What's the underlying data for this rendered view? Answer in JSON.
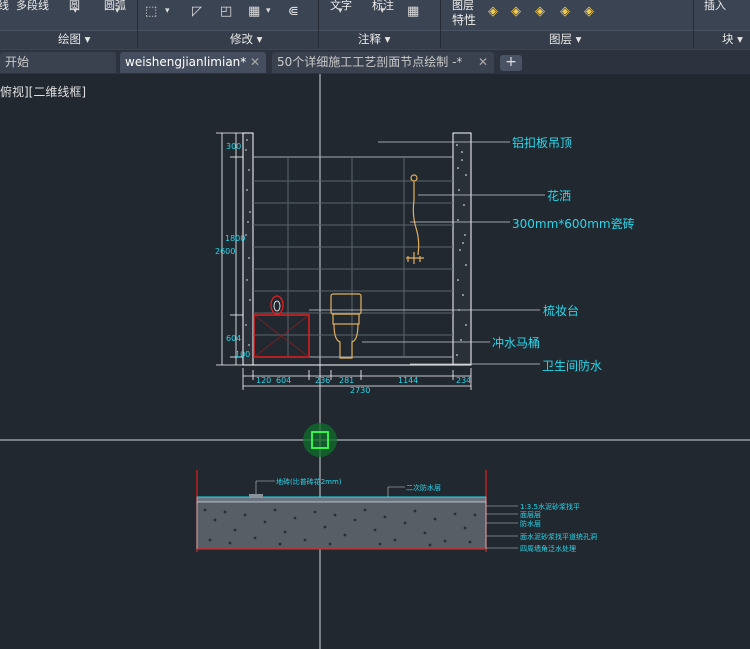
{
  "ribbon": {
    "items": {
      "line": "线",
      "polyline": "多段线",
      "circle": "圆",
      "arc": "圆弧",
      "text": "文字",
      "dimension": "标注",
      "layer_props": "图层",
      "props_2": "特性",
      "insert": "插入"
    },
    "panels": {
      "draw": "绘图 ▾",
      "modify": "修改 ▾",
      "annotation": "注释 ▾",
      "layers": "图层 ▾",
      "block": "块 ▾"
    }
  },
  "tabs": [
    {
      "label": "开始"
    },
    {
      "label": "weishengjianlimian*"
    },
    {
      "label": "50个详细施工工艺剖面节点绘制 -*"
    }
  ],
  "viewport": {
    "label": "俯视][二维线框]"
  },
  "drawing": {
    "elevation_labels": {
      "ceiling": "铝扣板吊顶",
      "shower": "花洒",
      "tile": "300mm*600mm瓷砖",
      "vanity": "梳妆台",
      "toilet": "冲水马桶",
      "waterproof": "卫生间防水"
    },
    "vertical_dims": [
      "300",
      "1800",
      "2600",
      "604",
      "100"
    ],
    "horizontal_dims": [
      "120",
      "604",
      "236",
      "281",
      "1144",
      "234"
    ],
    "total_dim": "2730",
    "section_labels": {
      "floor_tile": "地砖(比普砖花2mm)",
      "second_waterproof": "二次防水层",
      "cement_mortar": "1:3.5水泥砂浆找平",
      "bond_layer": "面层层",
      "waterproof_layer": "防水层",
      "leveling": "面水泥砂浆找平道统孔洞",
      "edge_treatment": "四周墙角泛水处理"
    }
  }
}
